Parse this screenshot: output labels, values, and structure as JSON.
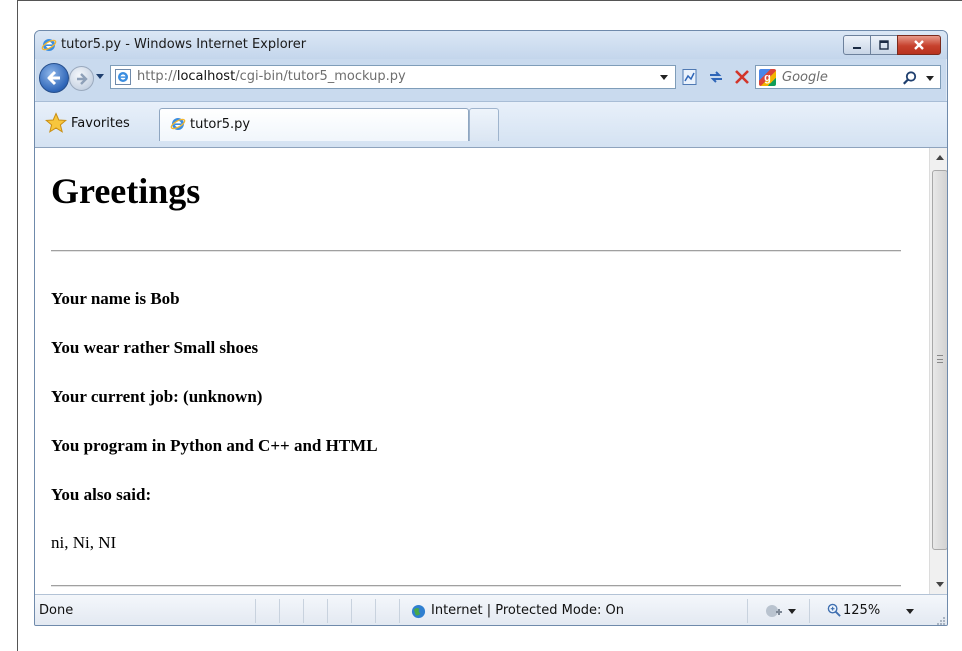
{
  "window": {
    "title": "tutor5.py - Windows Internet Explorer"
  },
  "address_bar": {
    "url_prefix": "http://",
    "url_host": "localhost",
    "url_path": "/cgi-bin/tutor5_mockup.py"
  },
  "search": {
    "placeholder": "Google"
  },
  "favorites_bar": {
    "favorites_label": "Favorites",
    "tabs": [
      {
        "label": "tutor5.py"
      }
    ]
  },
  "page": {
    "heading": "Greetings",
    "lines": [
      "Your name is Bob",
      "You wear rather Small shoes",
      "Your current job: (unknown)",
      "You program in Python and C++ and HTML",
      "You also said:"
    ],
    "said_text": "ni, Ni, NI"
  },
  "status_bar": {
    "status": "Done",
    "zone": "Internet | Protected Mode: On",
    "zoom": "125%"
  },
  "icons": {
    "title": "ie-logo-icon",
    "back": "back-arrow-icon",
    "forward": "forward-arrow-icon",
    "refresh": "refresh-icon",
    "stop": "stop-icon",
    "compat": "compatibility-view-icon",
    "search_go": "search-icon",
    "favorites": "favorites-star-icon"
  },
  "colors": {
    "close_button": "#c6412d",
    "frame": "#c9daee",
    "link_blue": "#2f66b8"
  }
}
